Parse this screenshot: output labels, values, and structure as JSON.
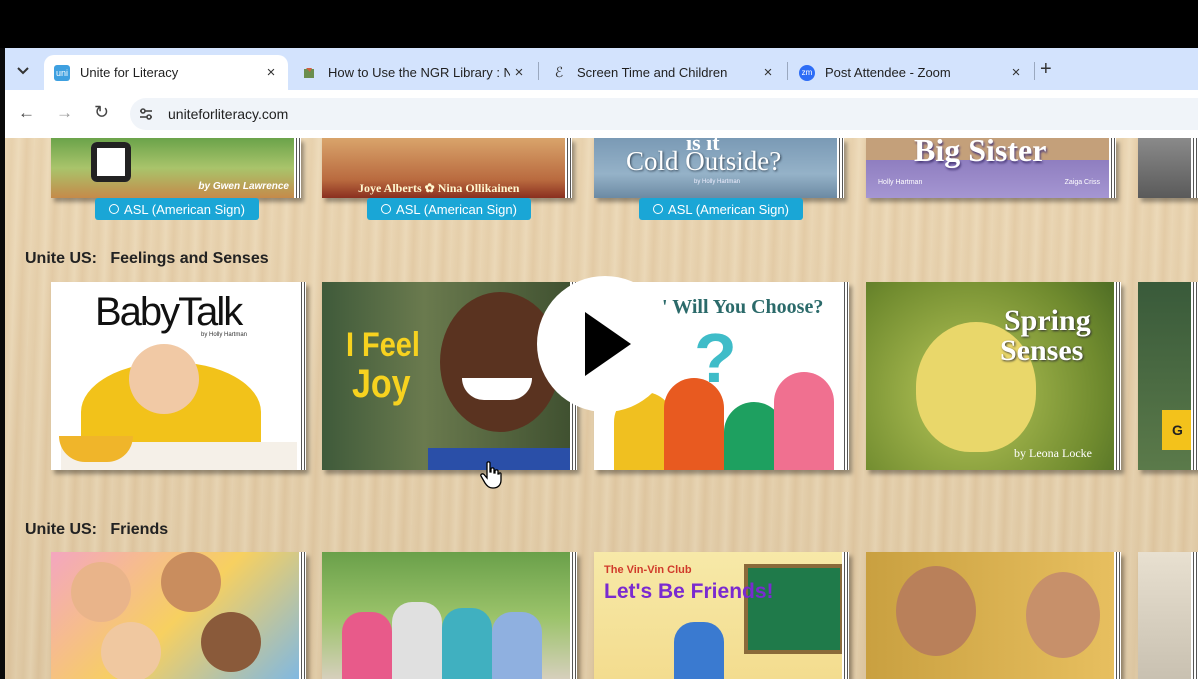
{
  "browser": {
    "tabs": [
      {
        "title": "Unite for Literacy",
        "active": true
      },
      {
        "title": "How to Use the NGR Library : N",
        "active": false
      },
      {
        "title": "Screen Time and Children",
        "active": false
      },
      {
        "title": "Post Attendee - Zoom",
        "active": false
      }
    ],
    "tab_close_glyph": "×",
    "new_tab_glyph": "+",
    "url": "uniteforliteracy.com",
    "nav": {
      "back": "←",
      "forward": "→",
      "reload": "↻"
    },
    "favicons": {
      "unite": "uni",
      "zoom": "zm",
      "screen": "ℰ"
    }
  },
  "top_row": {
    "books": [
      {
        "author": "by Gwen Lawrence"
      },
      {
        "author": "Joye Alberts ✿ Nina Ollikainen"
      },
      {
        "title": "Cold Outside?",
        "title_partial": "is it",
        "author": "by Holly Hartman"
      },
      {
        "title": "Big Sister",
        "author_left": "Holly Hartman",
        "author_right": "Zaiga Criss"
      }
    ],
    "asl_label": "ASL (American Sign)"
  },
  "sections": [
    {
      "title": "Unite US:   Feelings and Senses",
      "books": [
        {
          "title": "BabyTalk",
          "author": "by Holly Hartman"
        },
        {
          "title_line1": "I Feel",
          "title_line2": "Joy"
        },
        {
          "title": "' Will You Choose?",
          "symbol": "?"
        },
        {
          "title_line1": "Spring",
          "title_line2": "Senses",
          "author": "by Leona Locke"
        },
        {
          "partial_text": "G"
        }
      ]
    },
    {
      "title": "Unite US:   Friends",
      "books": [
        {},
        {},
        {
          "series": "The Vin-Vin Club",
          "title": "Let's Be Friends!"
        },
        {}
      ]
    }
  ],
  "colors": {
    "tabstrip": "#d3e3fd",
    "asl_button": "#1aa6d6",
    "wood": "#e9d3ae"
  },
  "icons": {
    "play": "play-icon",
    "cursor": "hand-pointer-icon"
  }
}
